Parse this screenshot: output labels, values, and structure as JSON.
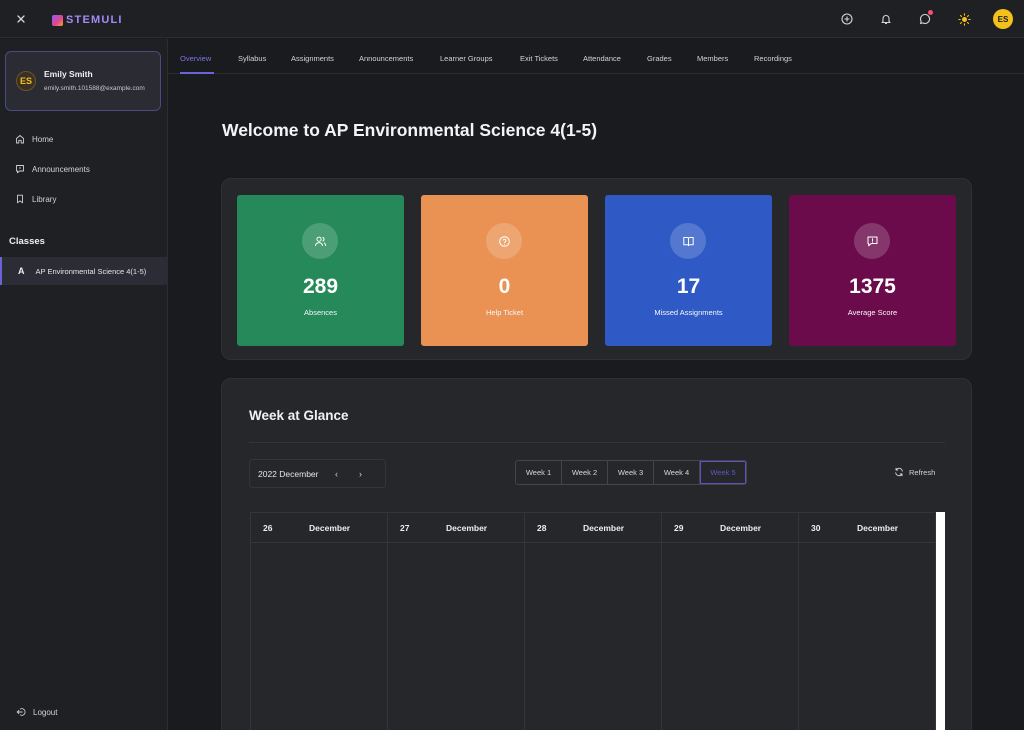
{
  "brand": {
    "name": "STEMULI"
  },
  "user": {
    "initials": "ES",
    "name": "Emily Smith",
    "email": "emily.smith.101588@example.com"
  },
  "sidebar": {
    "nav": [
      {
        "label": "Home",
        "icon": "home-icon"
      },
      {
        "label": "Announcements",
        "icon": "megaphone-icon"
      },
      {
        "label": "Library",
        "icon": "bookmark-icon"
      }
    ],
    "classes_heading": "Classes",
    "class_item": {
      "letter": "A",
      "label": "AP Environmental Science 4(1-5)"
    },
    "logout_label": "Logout"
  },
  "tabs": [
    "Overview",
    "Syllabus",
    "Assignments",
    "Announcements",
    "Learner Groups",
    "Exit Tickets",
    "Attendance",
    "Grades",
    "Members",
    "Recordings"
  ],
  "active_tab": "Overview",
  "welcome_title": "Welcome to AP Environmental Science 4(1-5)",
  "stats": [
    {
      "value": "289",
      "label": "Absences",
      "color": "#25895a",
      "icon": "users-icon"
    },
    {
      "value": "0",
      "label": "Help Ticket",
      "color": "#ea9254",
      "icon": "help-circle-icon"
    },
    {
      "value": "17",
      "label": "Missed Assignments",
      "color": "#2f5ac6",
      "icon": "book-icon"
    },
    {
      "value": "1375",
      "label": "Average Score",
      "color": "#6b0b4b",
      "icon": "message-square-icon"
    }
  ],
  "week_at_glance": {
    "title": "Week at Glance",
    "month_label": "2022 December",
    "prev_arrow": "‹",
    "next_arrow": "›",
    "weeks": [
      "Week 1",
      "Week 2",
      "Week 3",
      "Week 4",
      "Week 5"
    ],
    "active_week": "Week 5",
    "refresh_label": "Refresh",
    "days": [
      {
        "day": "26",
        "month": "December"
      },
      {
        "day": "27",
        "month": "December"
      },
      {
        "day": "28",
        "month": "December"
      },
      {
        "day": "29",
        "month": "December"
      },
      {
        "day": "30",
        "month": "December"
      }
    ]
  }
}
